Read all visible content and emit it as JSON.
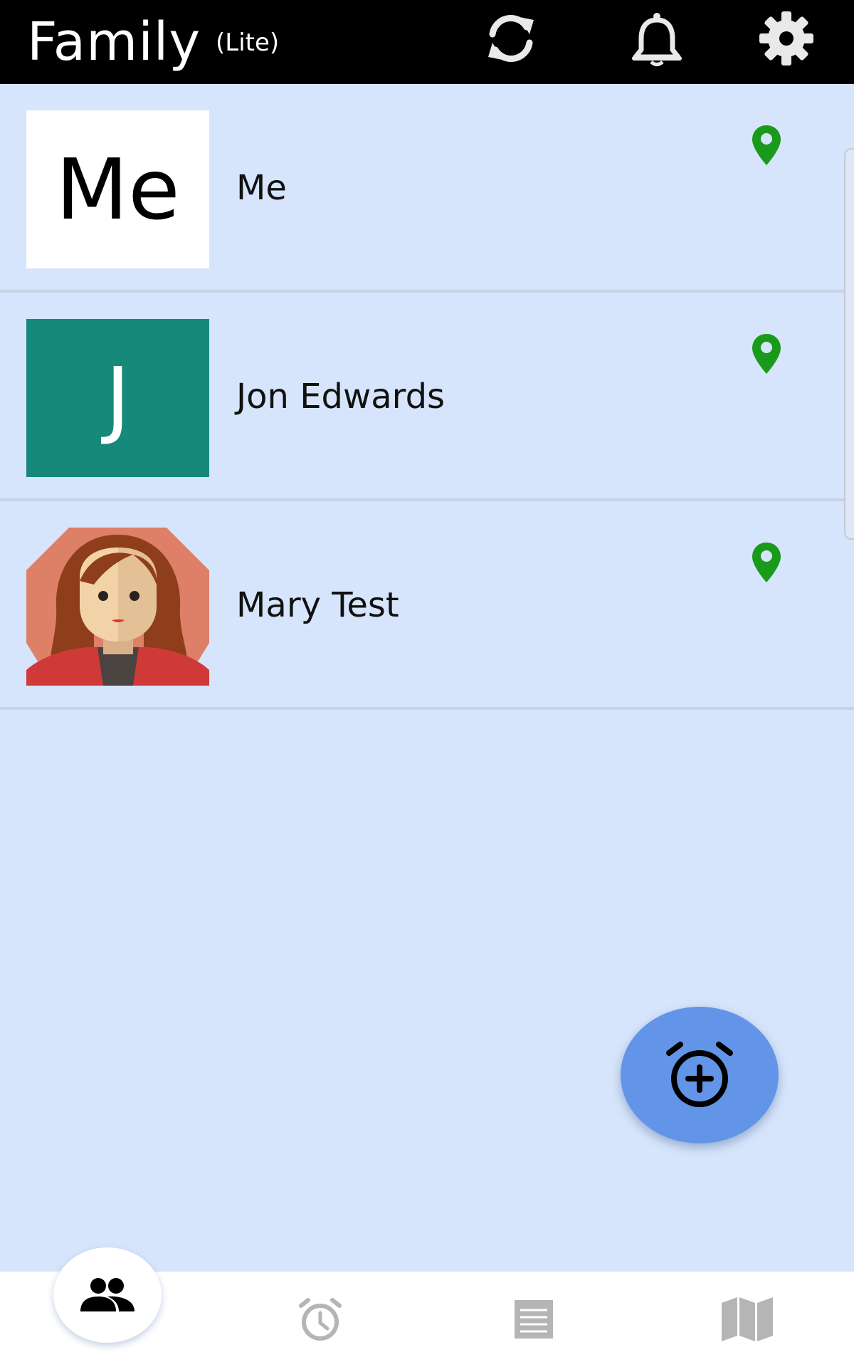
{
  "header": {
    "title": "Family",
    "subtitle": "(Lite)",
    "icons": [
      "sync-icon",
      "bell-icon",
      "gear-icon"
    ]
  },
  "members": [
    {
      "avatar_text": "Me",
      "name": "Me",
      "avatar_bg": "#ffffff",
      "location_icon": "map-pin-icon"
    },
    {
      "avatar_text": "J",
      "name": "Jon Edwards",
      "avatar_bg": "#16897a",
      "location_icon": "map-pin-icon"
    },
    {
      "avatar_text": "",
      "name": "Mary Test",
      "avatar_icon": "woman-avatar-icon",
      "location_icon": "map-pin-icon"
    }
  ],
  "fab": {
    "icon": "add-alarm-icon"
  },
  "bottom_nav": {
    "items": [
      {
        "icon": "people-icon",
        "active": true
      },
      {
        "icon": "alarm-clock-icon",
        "active": false
      },
      {
        "icon": "list-icon",
        "active": false
      },
      {
        "icon": "map-icon",
        "active": false
      }
    ]
  },
  "colors": {
    "background": "#d6e5fb",
    "topbar": "#000000",
    "pin": "#1a9a1a",
    "fab": "#6295e8",
    "inactive_nav": "#b5b5b5"
  }
}
